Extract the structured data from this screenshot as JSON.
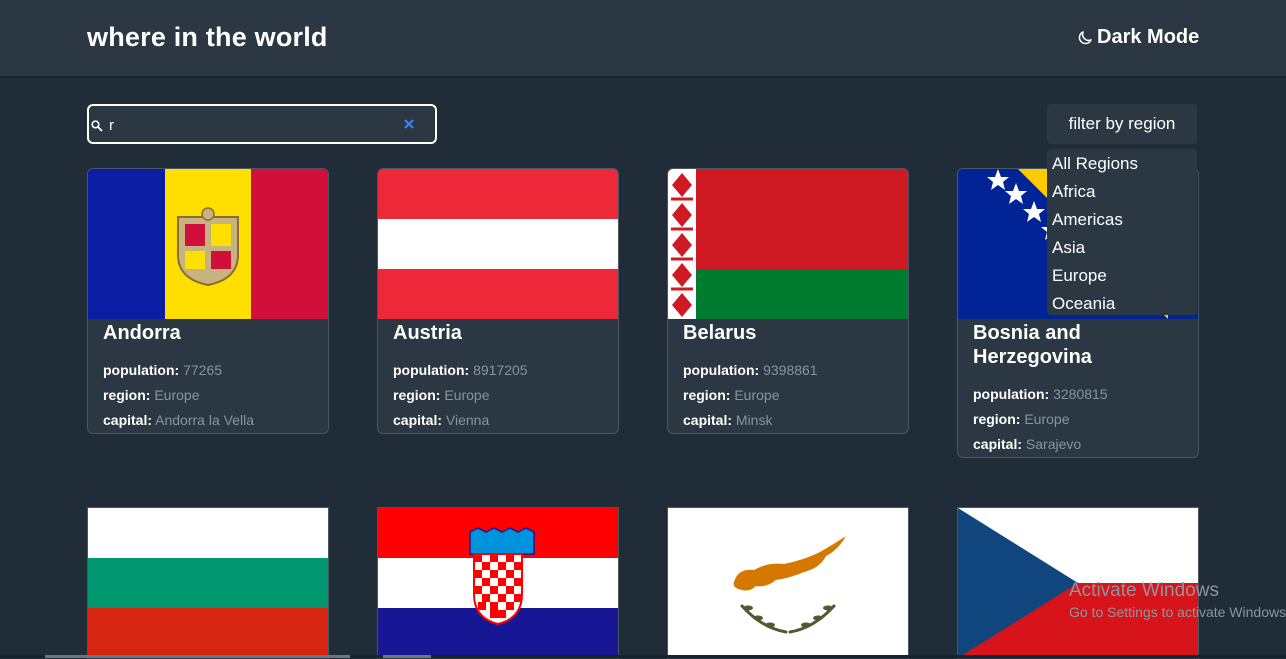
{
  "header": {
    "title": "where in the world",
    "mode_label": "Dark Mode"
  },
  "search": {
    "value": "r"
  },
  "filter": {
    "label": "filter by region",
    "options": [
      "All Regions",
      "Africa",
      "Americas",
      "Asia",
      "Europe",
      "Oceania"
    ]
  },
  "labels": {
    "population": "population:",
    "region": "region:",
    "capital": "capital:"
  },
  "countries": [
    {
      "name": "Andorra",
      "population": "77265",
      "region": "Europe",
      "capital": "Andorra la Vella"
    },
    {
      "name": "Austria",
      "population": "8917205",
      "region": "Europe",
      "capital": "Vienna"
    },
    {
      "name": "Belarus",
      "population": "9398861",
      "region": "Europe",
      "capital": "Minsk"
    },
    {
      "name": "Bosnia and Herzegovina",
      "population": "3280815",
      "region": "Europe",
      "capital": "Sarajevo"
    }
  ],
  "watermark": {
    "title": "Activate Windows",
    "subtitle": "Go to Settings to activate Windows."
  },
  "colors": {
    "background": "#202c37",
    "element": "#2b3743",
    "muted_text": "#8a949e"
  }
}
